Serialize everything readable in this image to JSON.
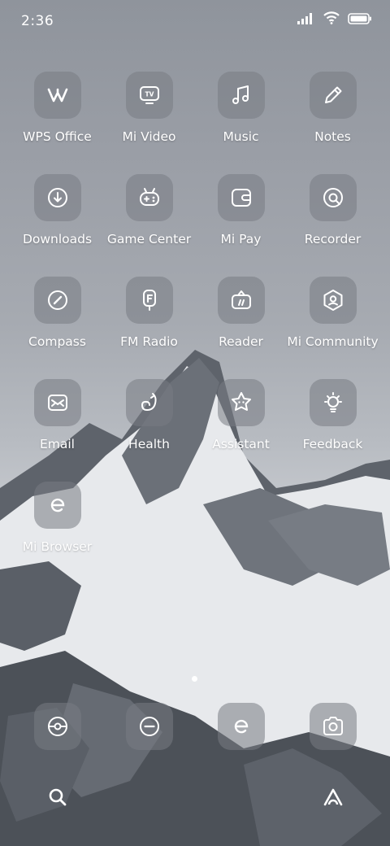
{
  "status_bar": {
    "time": "2:36",
    "icons": [
      "signal-icon",
      "wifi-icon",
      "battery-icon"
    ]
  },
  "apps": [
    {
      "label": "WPS Office",
      "icon": "wps-office-icon"
    },
    {
      "label": "Mi Video",
      "icon": "tv-icon"
    },
    {
      "label": "Music",
      "icon": "music-note-icon"
    },
    {
      "label": "Notes",
      "icon": "pencil-icon"
    },
    {
      "label": "Downloads",
      "icon": "download-icon"
    },
    {
      "label": "Game Center",
      "icon": "gamepad-icon"
    },
    {
      "label": "Mi Pay",
      "icon": "wallet-icon"
    },
    {
      "label": "Recorder",
      "icon": "recorder-icon"
    },
    {
      "label": "Compass",
      "icon": "compass-icon"
    },
    {
      "label": "FM Radio",
      "icon": "radio-icon"
    },
    {
      "label": "Reader",
      "icon": "book-icon"
    },
    {
      "label": "Mi Community",
      "icon": "community-icon"
    },
    {
      "label": "Email",
      "icon": "email-icon"
    },
    {
      "label": "Health",
      "icon": "health-icon"
    },
    {
      "label": "Assistant",
      "icon": "assistant-icon"
    },
    {
      "label": "Feedback",
      "icon": "bulb-icon"
    },
    {
      "label": "Mi Browser",
      "icon": "browser-icon"
    }
  ],
  "page_indicator": {
    "pages": 1,
    "current": 1
  },
  "dock": [
    "phone-icon",
    "messages-icon",
    "browser-icon",
    "camera-icon"
  ],
  "bottom_bar": [
    "search-icon",
    "assistant-a-icon"
  ],
  "colors": {
    "tile": "#787c84",
    "text": "#ffffff"
  }
}
